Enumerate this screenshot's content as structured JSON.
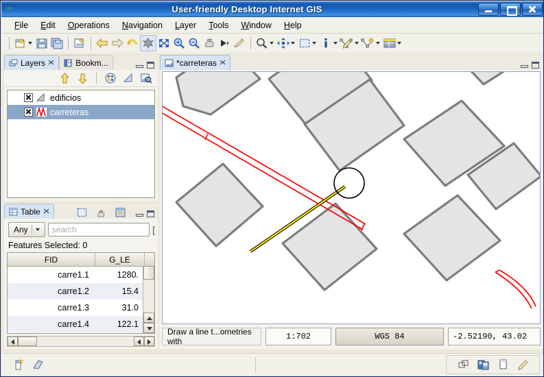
{
  "window": {
    "title": "User-friendly Desktop Internet GIS",
    "icon": "gvsig-cross-icon",
    "buttons": {
      "minimize": "minimize",
      "maximize": "maximize",
      "close": "close"
    }
  },
  "menubar": {
    "items": [
      {
        "label": "File",
        "mnemonic": "F"
      },
      {
        "label": "Edit",
        "mnemonic": "E"
      },
      {
        "label": "Operations",
        "mnemonic": "O"
      },
      {
        "label": "Navigation",
        "mnemonic": "N"
      },
      {
        "label": "Layer",
        "mnemonic": "L"
      },
      {
        "label": "Tools",
        "mnemonic": "T"
      },
      {
        "label": "Window",
        "mnemonic": "W"
      },
      {
        "label": "Help",
        "mnemonic": "H"
      }
    ]
  },
  "toolbar": {
    "items": [
      {
        "name": "new-project-icon",
        "caret": true
      },
      {
        "name": "save-icon",
        "caret": false
      },
      {
        "name": "save-as-icon",
        "caret": false
      },
      {
        "name": "new-view-icon",
        "caret": false
      },
      {
        "name": "back-arrow-icon",
        "caret": false
      },
      {
        "name": "forward-arrow-icon",
        "caret": false
      },
      {
        "name": "refresh-icon",
        "caret": false
      },
      {
        "name": "full-extent-icon",
        "caret": false,
        "active": true
      },
      {
        "name": "zoom-to-fit-icon",
        "caret": false
      },
      {
        "name": "zoom-in-icon",
        "caret": false
      },
      {
        "name": "zoom-out-icon",
        "caret": false
      },
      {
        "name": "pan-hand-icon",
        "caret": false
      },
      {
        "name": "zoom-prev-icon",
        "caret": false
      },
      {
        "name": "measure-icon",
        "caret": false
      },
      {
        "name": "zoom-tools-icon",
        "caret": true
      },
      {
        "name": "pan-tools-icon",
        "caret": true
      },
      {
        "name": "select-tools-icon",
        "caret": true
      },
      {
        "name": "info-icon",
        "caret": true
      },
      {
        "name": "edit-geometry-icon",
        "caret": true
      },
      {
        "name": "insert-vertex-icon",
        "caret": true
      },
      {
        "name": "table-tools-icon",
        "caret": true
      }
    ]
  },
  "layers_panel": {
    "tabs": [
      {
        "label": "Layers",
        "icon": "layers-icon",
        "active": true,
        "closable": true
      },
      {
        "label": "Bookm...",
        "icon": "bookmark-icon",
        "active": false,
        "closable": false
      }
    ],
    "tools": [
      {
        "name": "move-layer-up-icon"
      },
      {
        "name": "move-layer-down-icon"
      },
      {
        "name": "symbology-palette-icon"
      },
      {
        "name": "layer-properties-icon"
      },
      {
        "name": "add-layer-icon"
      }
    ],
    "layers": [
      {
        "label": "edificios",
        "checked": true,
        "selected": false,
        "symbol": "polygon-symbol"
      },
      {
        "label": "carreteras",
        "checked": true,
        "selected": true,
        "symbol": "line-symbol"
      }
    ]
  },
  "table_panel": {
    "tabs": [
      {
        "label": "Table",
        "icon": "table-icon",
        "active": true,
        "closable": true
      }
    ],
    "tools": [
      {
        "name": "select-all-icon"
      },
      {
        "name": "clear-selection-icon"
      },
      {
        "name": "export-table-icon"
      }
    ],
    "filter": {
      "selected": "Any",
      "options": [
        "Any"
      ]
    },
    "search": {
      "value": "",
      "placeholder": "search"
    },
    "features_selected_label": "Features Selected: 0",
    "columns": [
      "FID",
      "G_LE"
    ],
    "rows": [
      {
        "FID": "carre1.1",
        "G_LE": "1280."
      },
      {
        "FID": "carre1.2",
        "G_LE": "15.4"
      },
      {
        "FID": "carre1.3",
        "G_LE": "31.0"
      },
      {
        "FID": "carre1.4",
        "G_LE": "122.1"
      }
    ]
  },
  "map_panel": {
    "tabs": [
      {
        "label": "*carreteras",
        "icon": "view-icon",
        "active": true,
        "closable": true
      }
    ],
    "status": {
      "message": "Draw a line t...ometries with",
      "scale": "1:702",
      "crs": "WGS 84",
      "coordinates": "-2.52190, 43.02"
    }
  },
  "bottom_bar": {
    "left_icons": [
      {
        "name": "new-project-small-icon"
      },
      {
        "name": "open-project-small-icon"
      }
    ],
    "right_icons": [
      {
        "name": "tile-windows-icon"
      },
      {
        "name": "cascade-windows-icon"
      },
      {
        "name": "single-window-icon"
      },
      {
        "name": "edit-pencil-icon"
      }
    ]
  },
  "map_style": {
    "building_fill": "#e4e4e4",
    "building_stroke": "#7d7d7d",
    "road_color": "#ff0000",
    "drawing_line_color": "#ffe800",
    "drawing_line_dash": "#000000",
    "snap_circle_color": "#000000",
    "canvas_background": "#ffffff"
  }
}
